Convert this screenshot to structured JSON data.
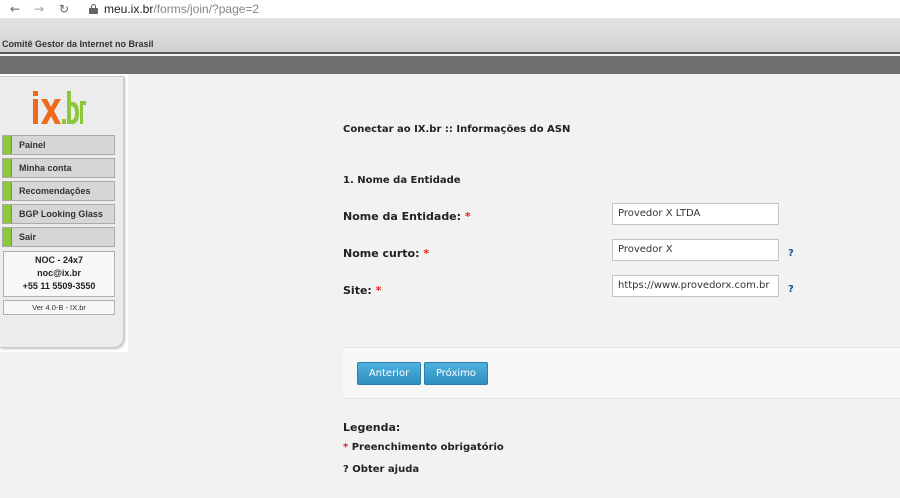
{
  "browser": {
    "url_host": "meu.ix.br",
    "url_path": "/forms/join/?page=2",
    "back_icon": "arrow-left-icon",
    "forward_icon": "arrow-right-icon",
    "reload_icon": "reload-icon",
    "lock_icon": "lock-icon"
  },
  "header": {
    "org_name": "Comitê Gestor da Internet no Brasil"
  },
  "sidebar": {
    "logo_text": "ix.br",
    "items": [
      {
        "label": "Painel"
      },
      {
        "label": "Minha conta"
      },
      {
        "label": "Recomendações"
      },
      {
        "label": "BGP Looking Glass"
      },
      {
        "label": "Sair"
      }
    ],
    "noc": {
      "title": "NOC - 24x7",
      "email": "noc@ix.br",
      "phone": "+55 11 5509-3550"
    },
    "version": "Ver 4.0-B - IX.br"
  },
  "form": {
    "page_title": "Conectar ao IX.br :: Informações do ASN",
    "section_title": "1. Nome da Entidade",
    "required_mark": "*",
    "help_mark": "?",
    "fields": [
      {
        "label": "Nome da Entidade:",
        "value": "Provedor X LTDA"
      },
      {
        "label": "Nome curto:",
        "value": "Provedor X"
      },
      {
        "label": "Site:",
        "value": "https://www.provedorx.com.br"
      }
    ],
    "buttons": {
      "prev": "Anterior",
      "next": "Próximo"
    }
  },
  "legend": {
    "title": "Legenda:",
    "required_mark": "*",
    "required_text": "Preenchimento obrigatório",
    "help_mark": "?",
    "help_text": "Obter ajuda"
  },
  "colors": {
    "menu_accent": "#8cc83c",
    "button": "#3a9fd0",
    "required": "#e2231a",
    "help": "#1a4fa0",
    "logo_orange": "#ee6b1e",
    "logo_green": "#8cc83c"
  }
}
